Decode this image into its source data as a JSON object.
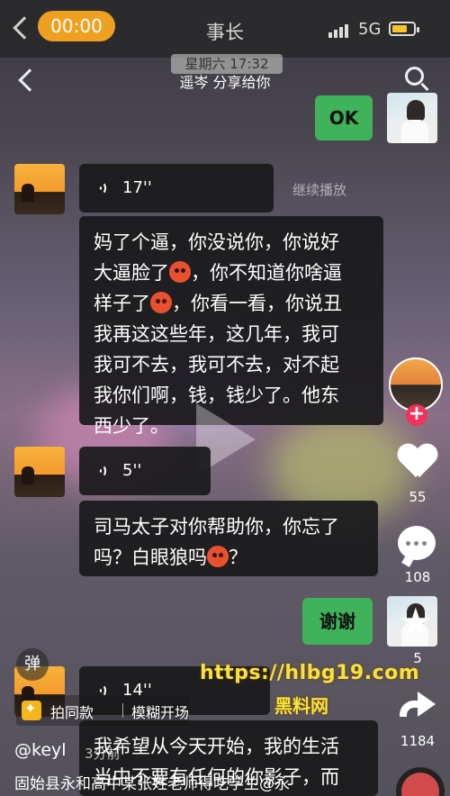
{
  "status_bar": {
    "timer": "00:00",
    "title": "事长",
    "network": "5G"
  },
  "chat_header": {
    "date": "星期六 17:32",
    "subtitle": "遥岑 分享给你"
  },
  "messages": {
    "ok": "OK",
    "voice1": "17''",
    "continue_play": "继续播放",
    "text1_lines": [
      "妈了个逼，你没说你，你说好",
      "大逼脸了",
      "，你不知道你啥逼",
      "样子了",
      "，你看一看，你说丑",
      "我再这这些年，这几年，我可",
      "我可不去，我可不去，对不起",
      "我你们啊，钱，钱少了。他东",
      "西少了。"
    ],
    "voice2": "5''",
    "text2_line1": "司马太子对你帮助你，你忘了",
    "text2_line2a": "吗？白眼狼吗",
    "text2_line2b": "？",
    "thanks": "谢谢",
    "voice3": "14''",
    "text3_line1": "我希望从今天开始，我的生活",
    "text3_line2": "当中不要有任何的你影子，而"
  },
  "rail": {
    "likes": "55",
    "comments": "108",
    "favorites": "5",
    "shares": "1184"
  },
  "bottom": {
    "danmu": "弹",
    "tag1": "拍同款",
    "tag2": "模糊开场",
    "author": "@keyl",
    "time_ago": "3分前",
    "caption": "固始县永和高中某张姓老师得吃学生@永"
  },
  "watermark": {
    "url": "https://hlbg19.com",
    "name": "黑料网"
  },
  "colors": {
    "accent_orange": "#f0a020",
    "bubble_green": "#3fb25a",
    "follow_pink": "#f2335b",
    "watermark_yellow": "#f3e53c"
  }
}
